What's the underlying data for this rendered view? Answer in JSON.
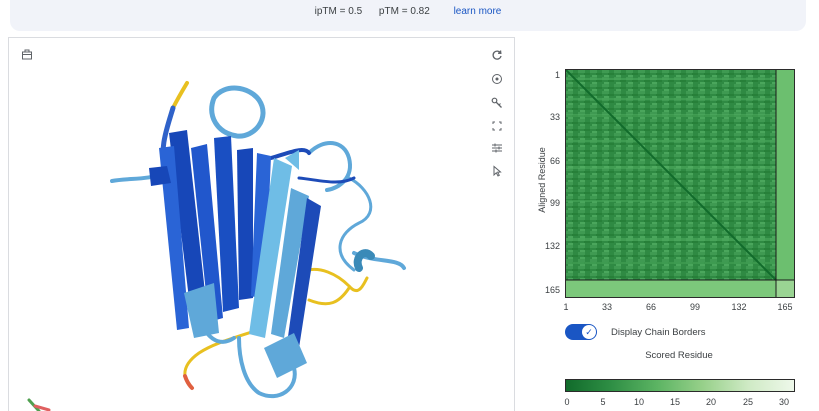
{
  "header": {
    "iptm": "ipTM = 0.5",
    "ptm": "pTM = 0.82",
    "learn_more": "learn more"
  },
  "viewer": {
    "tools": [
      "download-icon",
      "reset-icon",
      "target-icon",
      "key-icon",
      "fullscreen-icon",
      "settings-icon",
      "pointer-icon"
    ]
  },
  "pae": {
    "y_axis_label": "Aligned Residue",
    "x_axis_label": "Scored Residue",
    "ticks": [
      "1",
      "33",
      "66",
      "99",
      "132",
      "165"
    ],
    "chain_toggle_label": "Display Chain Borders",
    "chain_toggle_on": true,
    "colorbar_ticks": [
      "0",
      "5",
      "10",
      "15",
      "20",
      "25",
      "30"
    ],
    "colors": {
      "low": "#116b2b",
      "high": "#eef8ea",
      "accent": "#1a56c4"
    }
  }
}
